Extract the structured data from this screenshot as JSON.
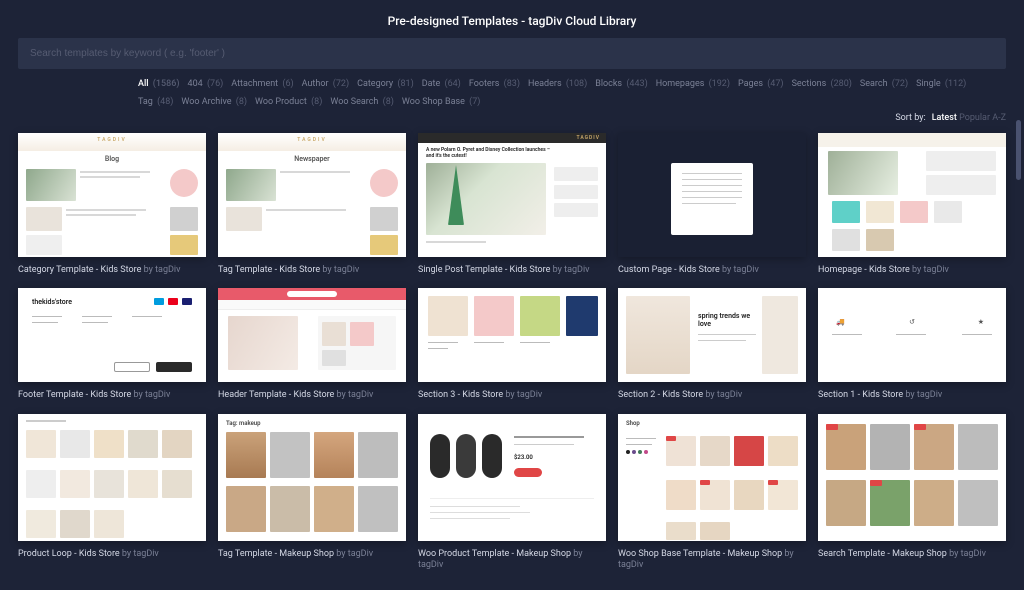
{
  "header": {
    "title": "Pre-designed Templates - tagDiv Cloud Library"
  },
  "search": {
    "placeholder": "Search templates by keyword ( e.g. 'footer' )"
  },
  "filters": [
    {
      "label": "All",
      "count": "(1586)",
      "active": true
    },
    {
      "label": "404",
      "count": "(76)"
    },
    {
      "label": "Attachment",
      "count": "(6)"
    },
    {
      "label": "Author",
      "count": "(72)"
    },
    {
      "label": "Category",
      "count": "(81)"
    },
    {
      "label": "Date",
      "count": "(64)"
    },
    {
      "label": "Footers",
      "count": "(83)"
    },
    {
      "label": "Headers",
      "count": "(108)"
    },
    {
      "label": "Blocks",
      "count": "(443)"
    },
    {
      "label": "Homepages",
      "count": "(192)"
    },
    {
      "label": "Pages",
      "count": "(47)"
    },
    {
      "label": "Sections",
      "count": "(280)"
    },
    {
      "label": "Search",
      "count": "(72)"
    },
    {
      "label": "Single",
      "count": "(112)"
    },
    {
      "label": "Tag",
      "count": "(48)"
    },
    {
      "label": "Woo Archive",
      "count": "(8)"
    },
    {
      "label": "Woo Product",
      "count": "(8)"
    },
    {
      "label": "Woo Search",
      "count": "(8)"
    },
    {
      "label": "Woo Shop Base",
      "count": "(7)"
    }
  ],
  "sort": {
    "label": "Sort by:",
    "options": [
      {
        "label": "Latest",
        "active": true
      },
      {
        "label": "Popular"
      },
      {
        "label": "A-Z"
      }
    ]
  },
  "by_word": "by",
  "cards": {
    "r1": [
      {
        "title": "Category Template - Kids Store",
        "author": "tagDiv"
      },
      {
        "title": "Tag Template - Kids Store",
        "author": "tagDiv"
      },
      {
        "title": "Single Post Template - Kids Store",
        "author": "tagDiv"
      },
      {
        "title": "Custom Page - Kids Store",
        "author": "tagDiv"
      },
      {
        "title": "Homepage - Kids Store",
        "author": "tagDiv"
      }
    ],
    "r2": [
      {
        "title": "Footer Template - Kids Store",
        "author": "tagDiv"
      },
      {
        "title": "Header Template - Kids Store",
        "author": "tagDiv"
      },
      {
        "title": "Section 3 - Kids Store",
        "author": "tagDiv"
      },
      {
        "title": "Section 2 - Kids Store",
        "author": "tagDiv"
      },
      {
        "title": "Section 1 - Kids Store",
        "author": "tagDiv"
      }
    ],
    "r3": [
      {
        "title": "Product Loop - Kids Store",
        "author": "tagDiv"
      },
      {
        "title": "Tag Template - Makeup Shop",
        "author": "tagDiv"
      },
      {
        "title": "Woo Product Template - Makeup Shop",
        "author": "tagDiv"
      },
      {
        "title": "Woo Shop Base Template - Makeup Shop",
        "author": "tagDiv"
      },
      {
        "title": "Search Template - Makeup Shop",
        "author": "tagDiv"
      }
    ]
  },
  "thumb_text": {
    "blog": "Blog",
    "newspaper": "Newspaper",
    "kidsstore": "thekids'store",
    "spring": "spring trends we love",
    "tagmakeup": "Tag: makeup",
    "shop": "Shop",
    "single_headline": "A new Polarn O. Pyret and Disney Collection launches – and it's the cutest!"
  }
}
